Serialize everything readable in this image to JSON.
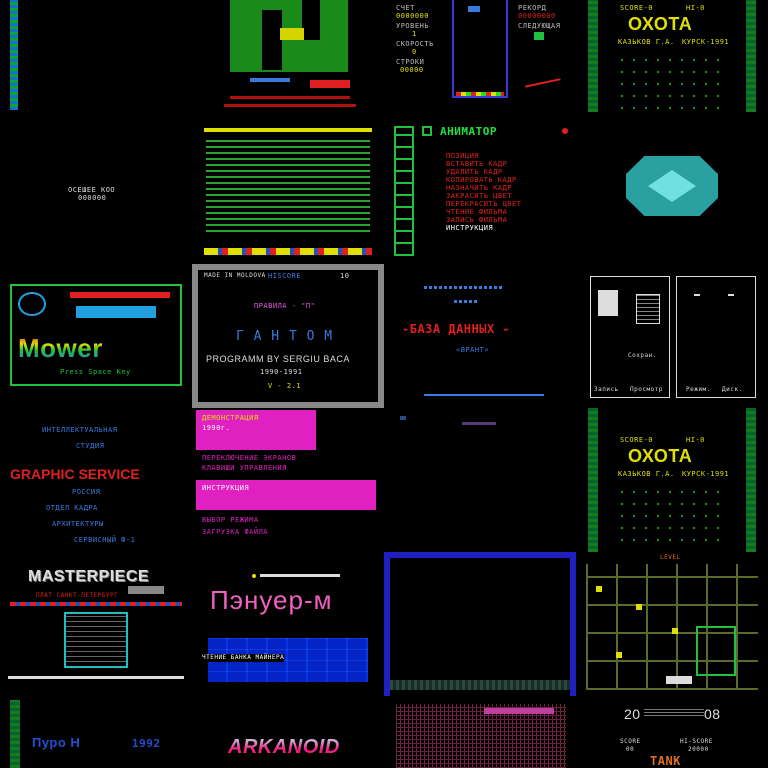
{
  "tiles": {
    "t02": {
      "score_label": "СЧЕТ",
      "score_val": "0000000",
      "level_label": "УРОВЕНЬ",
      "level_val": "1",
      "speed_label": "СКОРОСТЬ",
      "speed_val": "0",
      "lines_label": "СТРОКИ",
      "lines_val": "00000",
      "record_label": "РЕКОРД",
      "record_val": "00000000",
      "next_label": "СЛЕДУЮЩАЯ"
    },
    "t03": {
      "score1": "SCORE-0",
      "hiscore": "HI-0",
      "title": "ОХОТА",
      "author": "КАЗЬКОВ Г.А.",
      "course": "КУРСК-1991"
    },
    "t11": {
      "text1": "ОСЕШЕЕ КОО",
      "text2": "000000"
    },
    "t13": {
      "title": "АНИМАТОР",
      "items": [
        "ПОЗИЦИЯ",
        "ВСТАВИТЬ КАДР",
        "УДАЛИТЬ КАДР",
        "КОПИРОВАТЬ КАДР",
        "НАЗНАЧИТЬ КАДР",
        "ЗАКРАСИТЬ ЦВЕТ",
        "ПЕРЕКРАСИТЬ ЦВЕТ",
        "ЧТЕНИЕ ФИЛЬМА",
        "ЗАПИСЬ ФИЛЬМА",
        "ИНСТРУКЦИЯ"
      ]
    },
    "t20": {
      "title": "Mower",
      "press": "Press Space Key"
    },
    "t21": {
      "made": "MADE IN MOLDOVA",
      "hiscore_label": "HISCORE",
      "hiscore_val": "10",
      "rules": "ПРАВИЛА - \"П\"",
      "title": "Г А Н Т О М",
      "programm": "PROGRAMM BY SERGIU BACA",
      "years": "1990-1991",
      "version": "V - 2.1"
    },
    "t22": {
      "title": "-БАЗА ДАННЫХ -",
      "sub": "«ВРАНТ»"
    },
    "t23": {
      "btn_save": "Сохран.",
      "btn_write": "Запись",
      "btn_view": "Просмотр",
      "btn_rec": "Режим.",
      "btn_disk": "Диск."
    },
    "t30": {
      "l1": "ИНТЕЛЛЕКТУАЛЬНАЯ",
      "l2": "СТУДИЯ",
      "title": "GRAPHIC SERVICE",
      "l3": "РОССИЯ",
      "l4": "ОТДЕЛ КАДРА",
      "l5": "АРХИТЕКТУРЫ",
      "l6": "СЕРВИСНЫЙ Ф-1"
    },
    "t31": {
      "h1": "ДЕМОНСТРАЦИЯ",
      "h2": "1990г.",
      "h3": "ИНСТРУКЦИЯ",
      "body": [
        "ПЕРЕКЛЮЧЕНИЕ ЭКРАНОВ",
        "КЛАВИШИ УПРАВЛЕНИЯ",
        "ВЫБОР РЕЖИМА",
        "ЗАГРУЗКА ФАЙЛА"
      ]
    },
    "t33": {
      "score1": "SCORE-0",
      "hiscore": "HI-0",
      "title": "ОХОТА",
      "author": "КАЗЬКОВ Г.А.",
      "course": "КУРСК-1991"
    },
    "t40": {
      "title": "MASTERPIECE",
      "sub": "ПЛАТ САНКТ-ПЕТЕРБУРГ"
    },
    "t41": {
      "title": "Пэнуер-м",
      "line": "ЧТЕНИЕ БАНКА МАЙНЕРА"
    },
    "t43": {
      "level": "LEVEL"
    },
    "t50": {
      "title": "Пуро Н",
      "year": "1992"
    },
    "t51": {
      "title": "ARKANOID"
    },
    "t53": {
      "left": "20",
      "right": "08",
      "score_label": "SCORE",
      "score_val": "00",
      "hi_label": "HI-SCORE",
      "hi_val": "20000",
      "title": "TANK"
    }
  }
}
